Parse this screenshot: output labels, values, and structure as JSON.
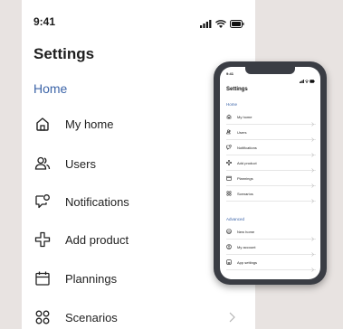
{
  "large": {
    "time": "9:41",
    "title": "Settings",
    "section": "Home",
    "items": [
      {
        "label": "My home"
      },
      {
        "label": "Users"
      },
      {
        "label": "Notifications"
      },
      {
        "label": "Add product"
      },
      {
        "label": "Plannings"
      },
      {
        "label": "Scenarios"
      }
    ]
  },
  "phone": {
    "time": "9:41",
    "title": "Settings",
    "section_home": "Home",
    "home_items": [
      {
        "label": "My home"
      },
      {
        "label": "Users"
      },
      {
        "label": "Notifications"
      },
      {
        "label": "Add product"
      },
      {
        "label": "Plannings"
      },
      {
        "label": "Scenarios"
      }
    ],
    "section_advanced": "Advanced",
    "advanced_items": [
      {
        "label": "New home"
      },
      {
        "label": "My account"
      },
      {
        "label": "App settings"
      }
    ]
  },
  "colors": {
    "accent": "#3c64a8",
    "background": "#e8e3e1",
    "phone_frame": "#3a3d44"
  },
  "icons": [
    "home-icon",
    "users-icon",
    "notifications-icon",
    "add-product-icon",
    "calendar-icon",
    "scenarios-icon",
    "chevron-right-icon",
    "signal-icon",
    "wifi-icon",
    "battery-icon",
    "user-circle-icon",
    "app-settings-icon"
  ]
}
